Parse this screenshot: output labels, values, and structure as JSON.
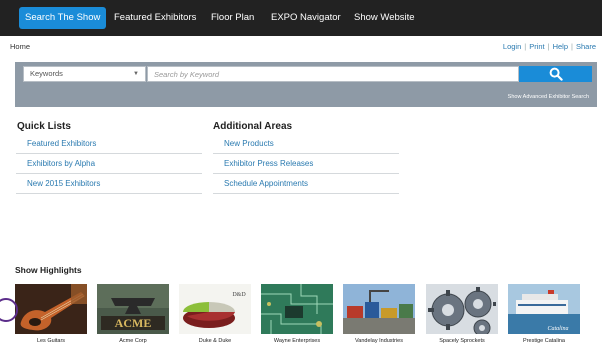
{
  "topnav": {
    "items": [
      "Search The Show",
      "Featured Exhibitors",
      "Floor Plan",
      "EXPO Navigator",
      "Show Website"
    ]
  },
  "breadcrumb": "Home",
  "utility": {
    "login": "Login",
    "print": "Print",
    "help": "Help",
    "share": "Share"
  },
  "search": {
    "select_value": "Keywords",
    "placeholder": "Search by Keyword",
    "advanced_link": "Show Advanced Exhibitor Search"
  },
  "quick_lists": {
    "title": "Quick Lists",
    "items": [
      "Featured Exhibitors",
      "Exhibitors by Alpha",
      "New 2015 Exhibitors"
    ]
  },
  "additional_areas": {
    "title": "Additional Areas",
    "items": [
      "New Products",
      "Exhibitor Press Releases",
      "Schedule Appointments"
    ]
  },
  "highlights": {
    "title": "Show Highlights",
    "items": [
      {
        "caption": "Les Guitars",
        "logo_text": ""
      },
      {
        "caption": "Acme Corp",
        "logo_text": "ACME"
      },
      {
        "caption": "Duke & Duke",
        "logo_text": "D&D"
      },
      {
        "caption": "Wayne Enterprises",
        "logo_text": ""
      },
      {
        "caption": "Vandelay Industries",
        "logo_text": ""
      },
      {
        "caption": "Spacely Sprockets",
        "logo_text": ""
      },
      {
        "caption": "Prestige Catalina",
        "logo_text": "Catalina"
      }
    ]
  },
  "colors": {
    "nav_bg": "#222222",
    "accent": "#1a8cd8",
    "link": "#2a7ab0",
    "panel": "#8e9aa6"
  }
}
